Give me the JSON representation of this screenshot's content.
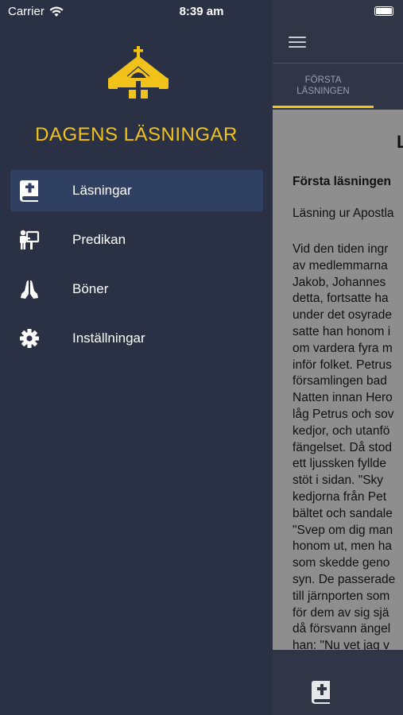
{
  "status_bar": {
    "carrier": "Carrier",
    "time": "8:39 am"
  },
  "drawer": {
    "app_title": "DAGENS LÄSNINGAR",
    "menu": [
      {
        "label": "Läsningar",
        "icon": "bible-book-icon",
        "active": true
      },
      {
        "label": "Predikan",
        "icon": "preacher-lectern-icon",
        "active": false
      },
      {
        "label": "Böner",
        "icon": "praying-hands-icon",
        "active": false
      },
      {
        "label": "Inställningar",
        "icon": "gear-icon",
        "active": false
      }
    ]
  },
  "main": {
    "tab_label_line1": "FÖRSTA",
    "tab_label_line2": "LÄSNINGEN",
    "content": {
      "title_fragment": "L",
      "heading": "Första läsningen",
      "subheading": "Läsning ur Apostla",
      "body_lines": [
        "Vid den tiden ingr",
        "av medlemmarna",
        "Jakob, Johannes",
        "detta, fortsatte ha",
        "under det osyrade",
        "satte han honom i",
        "om vardera fyra m",
        "inför folket. Petrus",
        "församlingen bad",
        "Natten innan Hero",
        "låg Petrus och sov",
        "kedjor, och utanfö",
        "fängelset. Då stod",
        "ett ljussken fyllde",
        "stöt i sidan. \"Sky",
        "kedjorna från Pet",
        "bältet och sandale",
        "\"Svep om dig man",
        "honom ut, men ha",
        "som skedde geno",
        "syn. De passerade",
        "till järnporten som",
        "för dem av sig sjä",
        "då försvann ängel",
        "han: \"Nu vet jag v"
      ]
    }
  },
  "colors": {
    "accent": "#f1c21a",
    "drawer_bg": "#2b3145",
    "active_item_bg": "#2f4063"
  }
}
